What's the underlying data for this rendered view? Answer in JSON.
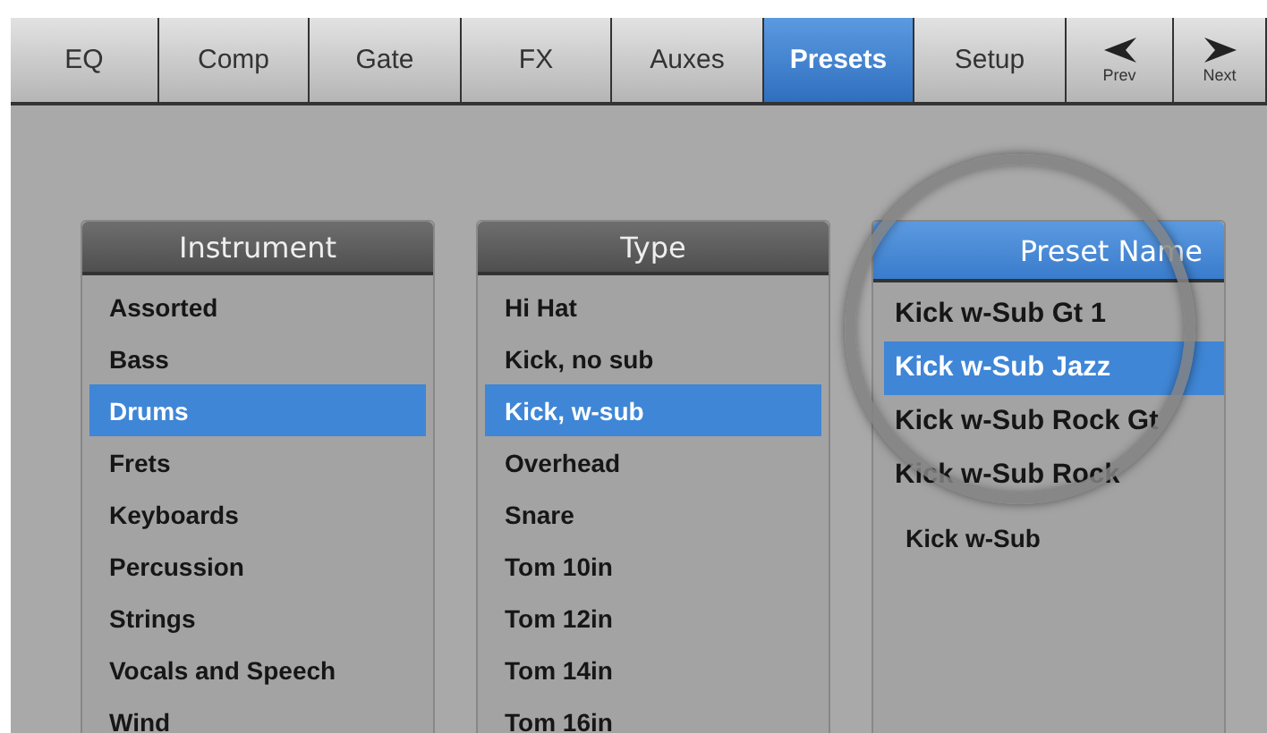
{
  "tabs": [
    {
      "label": "EQ",
      "kind": "text",
      "selected": false
    },
    {
      "label": "Comp",
      "kind": "text",
      "selected": false
    },
    {
      "label": "Gate",
      "kind": "text",
      "selected": false
    },
    {
      "label": "FX",
      "kind": "text",
      "selected": false
    },
    {
      "label": "Auxes",
      "kind": "text",
      "selected": false
    },
    {
      "label": "Presets",
      "kind": "text",
      "selected": true
    },
    {
      "label": "Setup",
      "kind": "text",
      "selected": false
    },
    {
      "label": "Prev",
      "kind": "prev",
      "selected": false
    },
    {
      "label": "Next",
      "kind": "next",
      "selected": false
    }
  ],
  "columns": [
    {
      "title": "Instrument",
      "active": false,
      "magnified": false,
      "items": [
        {
          "label": "Assorted",
          "selected": false
        },
        {
          "label": "Bass",
          "selected": false
        },
        {
          "label": "Drums",
          "selected": true
        },
        {
          "label": "Frets",
          "selected": false
        },
        {
          "label": "Keyboards",
          "selected": false
        },
        {
          "label": "Percussion",
          "selected": false
        },
        {
          "label": "Strings",
          "selected": false
        },
        {
          "label": "Vocals and Speech",
          "selected": false
        },
        {
          "label": "Wind",
          "selected": false
        }
      ]
    },
    {
      "title": "Type",
      "active": false,
      "magnified": false,
      "items": [
        {
          "label": "Hi Hat",
          "selected": false
        },
        {
          "label": "Kick, no sub",
          "selected": false
        },
        {
          "label": "Kick, w-sub",
          "selected": true
        },
        {
          "label": "Overhead",
          "selected": false
        },
        {
          "label": "Snare",
          "selected": false
        },
        {
          "label": "Tom 10in",
          "selected": false
        },
        {
          "label": "Tom 12in",
          "selected": false
        },
        {
          "label": "Tom 14in",
          "selected": false
        },
        {
          "label": "Tom 16in",
          "selected": false
        }
      ]
    },
    {
      "title": "Preset Name",
      "active": true,
      "magnified": true,
      "items": [
        {
          "label": "Kick w-Sub Gt 1",
          "selected": false
        },
        {
          "label": "Kick w-Sub Jazz",
          "selected": true
        },
        {
          "label": "Kick w-Sub Rock Gt",
          "selected": false
        },
        {
          "label": "Kick w-Sub Rock",
          "selected": false
        },
        {
          "label": "Kick w-Sub",
          "selected": false
        }
      ]
    }
  ]
}
